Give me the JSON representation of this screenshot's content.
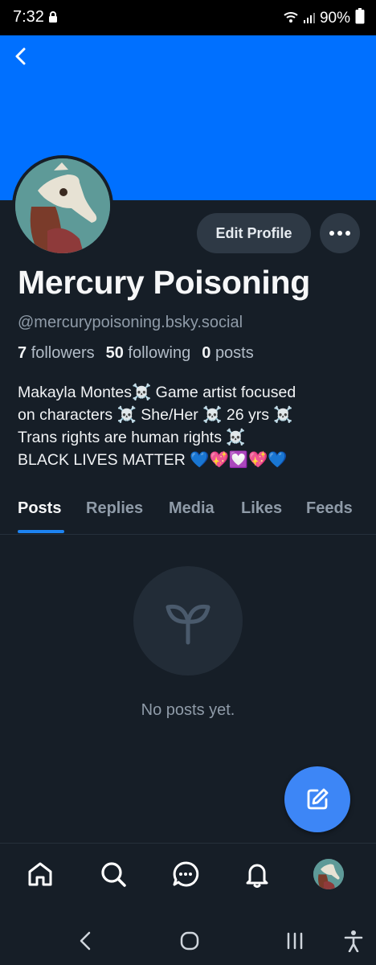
{
  "status_bar": {
    "time": "7:32",
    "battery": "90%"
  },
  "colors": {
    "banner": "#0070ff",
    "accent": "#1d83f1",
    "fab": "#3d86f6",
    "background": "#161e27"
  },
  "profile": {
    "display_name": "Mercury Poisoning",
    "handle": "@mercurypoisoning.bsky.social",
    "followers_count": "7",
    "followers_label": "followers",
    "following_count": "50",
    "following_label": "following",
    "posts_count": "0",
    "posts_label": "posts",
    "bio_lines": [
      "Makayla Montes☠️ Game artist focused",
      "on characters  ☠️ She/Her  ☠️ 26 yrs   ☠️",
      "Trans rights are human rights  ☠️",
      "BLACK LIVES MATTER  💙💖💟💖💙"
    ]
  },
  "actions": {
    "edit_profile": "Edit Profile",
    "more_icon": "ellipsis-icon"
  },
  "tabs": [
    {
      "label": "Posts",
      "active": true
    },
    {
      "label": "Replies",
      "active": false
    },
    {
      "label": "Media",
      "active": false
    },
    {
      "label": "Likes",
      "active": false
    },
    {
      "label": "Feeds",
      "active": false
    }
  ],
  "empty_state": {
    "message": "No posts yet.",
    "icon": "seedling-icon"
  },
  "fab": {
    "icon": "compose-icon"
  },
  "bottom_nav": [
    {
      "icon": "home-icon"
    },
    {
      "icon": "search-icon"
    },
    {
      "icon": "chat-icon"
    },
    {
      "icon": "bell-icon"
    },
    {
      "icon": "avatar"
    }
  ],
  "system_nav": [
    {
      "icon": "back-icon"
    },
    {
      "icon": "home-circle-icon"
    },
    {
      "icon": "recents-icon"
    },
    {
      "icon": "accessibility-icon"
    }
  ]
}
